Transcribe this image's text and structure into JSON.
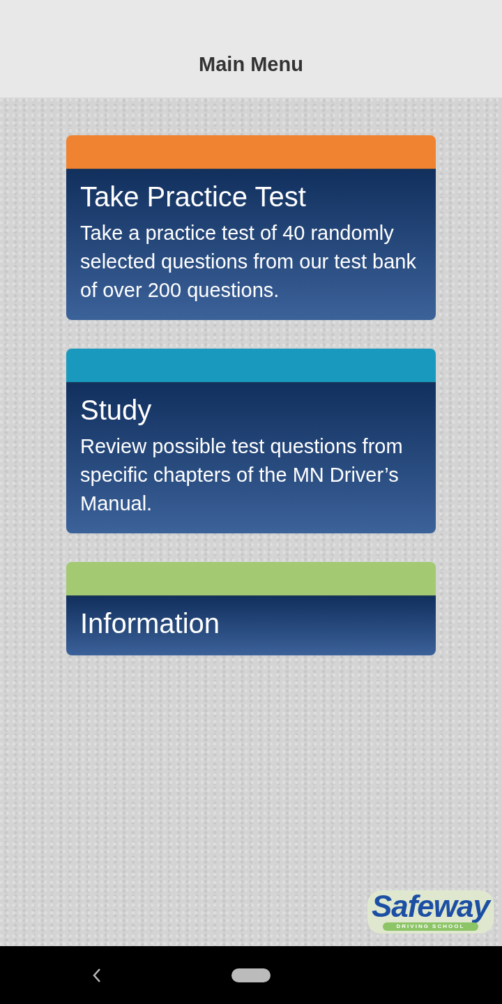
{
  "header": {
    "title": "Main Menu"
  },
  "menu_items": [
    {
      "title": "Take Practice Test",
      "description": "Take a practice test of 40 randomly selected questions from our test bank of over 200 questions.",
      "color": "#f08331"
    },
    {
      "title": "Study",
      "description": "Review possible test questions from specific chapters of the MN Driver’s Manual.",
      "color": "#1899bd"
    },
    {
      "title": "Information",
      "color": "#a3ca72"
    }
  ],
  "logo": {
    "name": "Safeway",
    "tagline": "DRIVING SCHOOL"
  }
}
